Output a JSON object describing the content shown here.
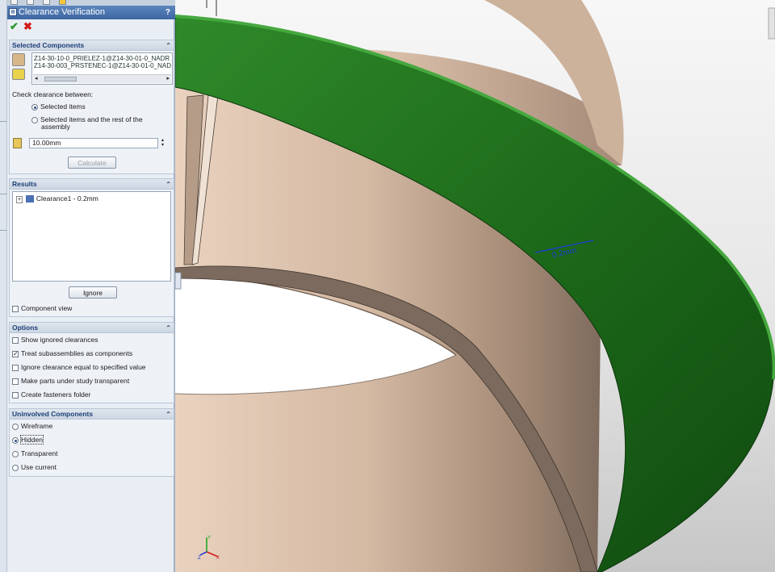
{
  "panel": {
    "title": "Clearance Verification",
    "help": "?",
    "ok_glyph": "✔",
    "cancel_glyph": "✖"
  },
  "selected": {
    "header": "Selected Components",
    "items": [
      "Z14-30-10-0_PRIELEZ-1@Z14-30-01-0_NADR",
      "Z14-30-003_PRSTENEC-1@Z14-30-01-0_NAD"
    ],
    "check_between_label": "Check clearance between:",
    "option_selected": "Selected items",
    "option_rest_line1": "Selected items and the rest of the",
    "option_rest_line2": "assembly",
    "distance_value": "10.00mm",
    "calculate_label": "Calculate"
  },
  "results": {
    "header": "Results",
    "tree_item": "Clearance1 - 0.2mm",
    "ignore_label": "Ignore",
    "component_view_label": "Component view"
  },
  "options": {
    "header": "Options",
    "items": [
      {
        "label": "Show ignored clearances",
        "checked": false
      },
      {
        "label": "Treat subassemblies as components",
        "checked": true
      },
      {
        "label": "Ignore clearance equal to specified value",
        "checked": false
      },
      {
        "label": "Make parts under study transparent",
        "checked": false
      },
      {
        "label": "Create fasteners folder",
        "checked": false
      }
    ]
  },
  "uninvolved": {
    "header": "Uninvolved Components",
    "items": [
      {
        "label": "Wireframe",
        "selected": false
      },
      {
        "label": "Hidden",
        "selected": true
      },
      {
        "label": "Transparent",
        "selected": false
      },
      {
        "label": "Use current",
        "selected": false
      }
    ]
  },
  "viewport": {
    "annotation_text": "0.2mm",
    "axis_labels": [
      "Y",
      "X",
      "Z"
    ],
    "colors": {
      "ring_green": "#1f6e1c",
      "cylinder_tan": "#d8bfa8",
      "background_top": "#f3f3f3",
      "background_bottom": "#c9c9c9"
    }
  }
}
